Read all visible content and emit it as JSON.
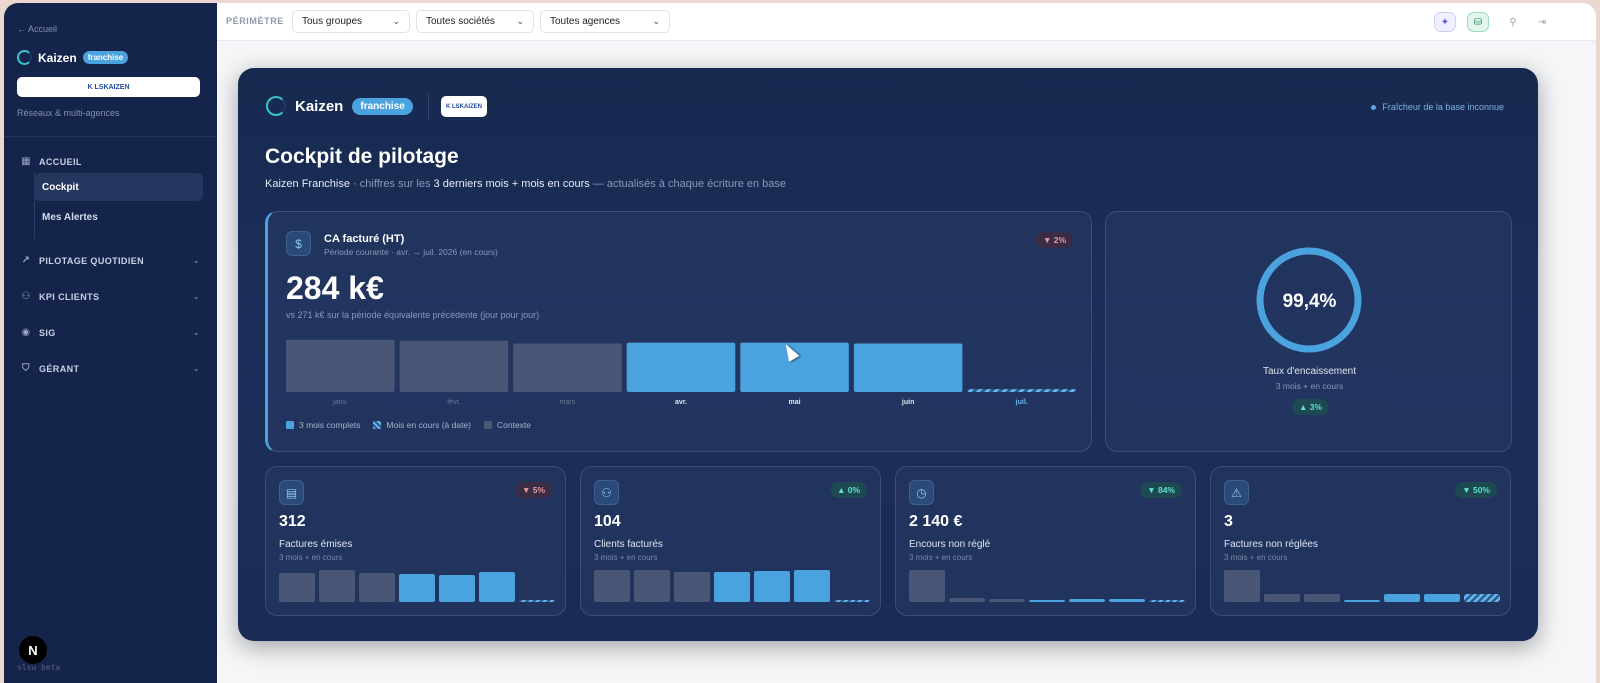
{
  "sidebar": {
    "back": "← Accueil",
    "brand": "Kaizen",
    "badge": "franchise",
    "logo_text": "K LSKAIZEN",
    "reseaux": "Réseaux & multi-agences",
    "sections": [
      {
        "label": "ACCUEIL",
        "icon": "grid-icon"
      },
      {
        "label": "PILOTAGE QUOTIDIEN",
        "icon": "trend-icon"
      },
      {
        "label": "KPI CLIENTS",
        "icon": "users-icon"
      },
      {
        "label": "SIG",
        "icon": "pin-icon"
      },
      {
        "label": "GÉRANT",
        "icon": "shield-icon"
      }
    ],
    "items": [
      {
        "label": "Cockpit",
        "active": true
      },
      {
        "label": "Mes Alertes",
        "active": false
      }
    ],
    "next_glyph": "N",
    "beta": "slsw beta"
  },
  "topbar": {
    "perimetre": "PÉRIMÈTRE",
    "groups": "Tous groupes",
    "societes": "Toutes sociétés",
    "agences": "Toutes agences"
  },
  "header": {
    "brand": "Kaizen",
    "badge": "franchise",
    "logo_text": "K LSKAIZEN",
    "freshness": "Fraîcheur de la base inconnue"
  },
  "page": {
    "title": "Cockpit de pilotage",
    "subtitle_pre": "Kaizen Franchise",
    "subtitle_mid": " · chiffres sur les ",
    "subtitle_hl": "3 derniers mois + mois en cours",
    "subtitle_post": " — actualisés à chaque écriture en base"
  },
  "ca_card": {
    "title": "CA facturé (HT)",
    "period": "Période courante · avr. → juil. 2026 (en cours)",
    "delta": "▼ 2%",
    "value": "284 k€",
    "vs": "vs 271 k€ sur la période équivalente précédente (jour pour jour)",
    "legend": [
      "3 mois complets",
      "Mois en cours (à date)",
      "Contexte"
    ]
  },
  "rate_card": {
    "value": "99,4%",
    "label": "Taux d'encaissement",
    "sub": "3 mois + en cours",
    "delta": "▲ 3%",
    "fraction": 0.994
  },
  "kpis": [
    {
      "value": "312",
      "label": "Factures émises",
      "sub": "3 mois + en cours",
      "delta": "▼ 5%",
      "dir": "down",
      "icon": "document-icon",
      "bars": [
        29,
        32,
        29,
        28,
        27,
        30,
        2
      ]
    },
    {
      "value": "104",
      "label": "Clients facturés",
      "sub": "3 mois + en cours",
      "delta": "▲ 0%",
      "dir": "up",
      "icon": "users-icon",
      "bars": [
        32,
        32,
        30,
        30,
        31,
        32,
        2
      ]
    },
    {
      "value": "2 140 €",
      "label": "Encours non réglé",
      "sub": "3 mois + en cours",
      "delta": "▼ 84%",
      "dir": "up",
      "icon": "clock-icon",
      "bars": [
        32,
        4,
        3,
        2,
        3,
        3,
        2
      ]
    },
    {
      "value": "3",
      "label": "Factures non réglées",
      "sub": "3 mois + en cours",
      "delta": "▼ 50%",
      "dir": "up",
      "icon": "warning-icon",
      "bars": [
        32,
        8,
        8,
        2,
        8,
        8,
        8
      ]
    }
  ],
  "colors": {
    "accent": "#4aa3de",
    "context": "#4a5676",
    "teal": "#36c6c8",
    "down": "#e89aa0",
    "up": "#5ee0c6"
  },
  "chart_data": {
    "type": "bar",
    "categories": [
      "janv.",
      "févr.",
      "mars",
      "avr.",
      "mai",
      "juin",
      "juil."
    ],
    "values": [
      55,
      54,
      51,
      52,
      52,
      51,
      3
    ],
    "kinds": [
      "context",
      "context",
      "context",
      "complete",
      "complete",
      "complete",
      "current"
    ],
    "ylim": [
      0,
      60
    ]
  }
}
